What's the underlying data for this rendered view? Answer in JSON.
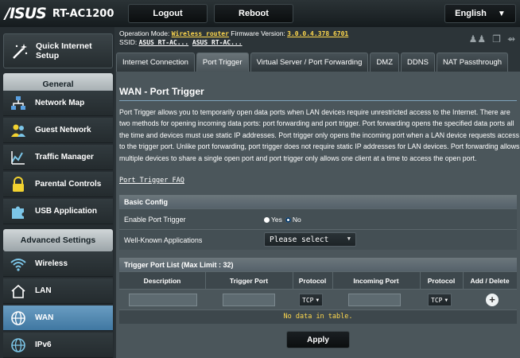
{
  "header": {
    "brand": "/ISUS",
    "model": "RT-AC1200",
    "logout_label": "Logout",
    "reboot_label": "Reboot",
    "language_label": "English"
  },
  "sidebar": {
    "quick_setup_label": "Quick Internet Setup",
    "general_header": "General",
    "general_items": [
      {
        "label": "Network Map",
        "icon": "network-map-icon"
      },
      {
        "label": "Guest Network",
        "icon": "guest-network-icon"
      },
      {
        "label": "Traffic Manager",
        "icon": "traffic-manager-icon"
      },
      {
        "label": "Parental Controls",
        "icon": "parental-controls-icon"
      },
      {
        "label": "USB Application",
        "icon": "usb-application-icon"
      }
    ],
    "advanced_header": "Advanced Settings",
    "advanced_items": [
      {
        "label": "Wireless",
        "icon": "wireless-icon"
      },
      {
        "label": "LAN",
        "icon": "lan-icon"
      },
      {
        "label": "WAN",
        "icon": "wan-icon",
        "active": true
      },
      {
        "label": "IPv6",
        "icon": "ipv6-icon"
      }
    ]
  },
  "status": {
    "opmode_prefix": "Operation Mode: ",
    "opmode_value": "Wireless router",
    "firmware_prefix": "  Firmware Version: ",
    "firmware_value": "3.0.0.4.378_6701",
    "ssid_prefix": "SSID: ",
    "ssid_1": "ASUS RT-AC...",
    "ssid_2": "ASUS RT-AC..."
  },
  "tabs": [
    {
      "label": "Internet Connection",
      "active": false
    },
    {
      "label": "Port Trigger",
      "active": true
    },
    {
      "label": "Virtual Server / Port Forwarding",
      "active": false
    },
    {
      "label": "DMZ",
      "active": false
    },
    {
      "label": "DDNS",
      "active": false
    },
    {
      "label": "NAT Passthrough",
      "active": false
    }
  ],
  "page": {
    "title": "WAN - Port Trigger",
    "description": "Port Trigger allows you to temporarily open data ports when LAN devices require unrestricted access to the Internet. There are two methods for opening incoming data ports: port forwarding and port trigger. Port forwarding opens the specified data ports all the time and devices must use static IP addresses. Port trigger only opens the incoming port when a LAN device requests access to the trigger port. Unlike port forwarding, port trigger does not require static IP addresses for LAN devices. Port forwarding allows multiple devices to share a single open port and port trigger only allows one client at a time to access the open port.",
    "faq_link": "Port Trigger FAQ"
  },
  "basic_config": {
    "header": "Basic Config",
    "enable_label": "Enable Port Trigger",
    "yes_label": "Yes",
    "no_label": "No",
    "selected": "No",
    "apps_label": "Well-Known Applications",
    "apps_value": "Please select"
  },
  "trigger_list": {
    "header": "Trigger Port List (Max Limit : 32)",
    "columns": [
      "Description",
      "Trigger Port",
      "Protocol",
      "Incoming Port",
      "Protocol",
      "Add / Delete"
    ],
    "protocol_1": "TCP",
    "protocol_2": "TCP",
    "no_data": "No data in table."
  },
  "apply_label": "Apply"
}
